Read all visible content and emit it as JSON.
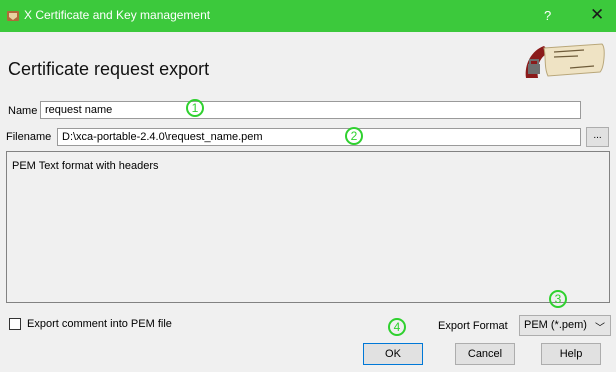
{
  "window": {
    "title": "X Certificate and Key management",
    "help_label": "?",
    "close_label": "✕"
  },
  "dialog": {
    "heading": "Certificate request export"
  },
  "name_field": {
    "label": "Name",
    "value": "request name"
  },
  "filename_field": {
    "label": "Filename",
    "value": "D:\\xca-portable-2.4.0\\request_name.pem",
    "browse_label": "..."
  },
  "description": "PEM Text format with headers",
  "export_comment": {
    "label": "Export comment into PEM file",
    "checked": false
  },
  "export_format": {
    "label": "Export Format",
    "selected": "PEM (*.pem)"
  },
  "buttons": {
    "ok": "OK",
    "cancel": "Cancel",
    "help": "Help"
  },
  "markers": [
    "1",
    "2",
    "3",
    "4"
  ],
  "colors": {
    "titlebar": "#3cc93c",
    "marker": "#2fd12f",
    "default_button_border": "#0078d7"
  }
}
